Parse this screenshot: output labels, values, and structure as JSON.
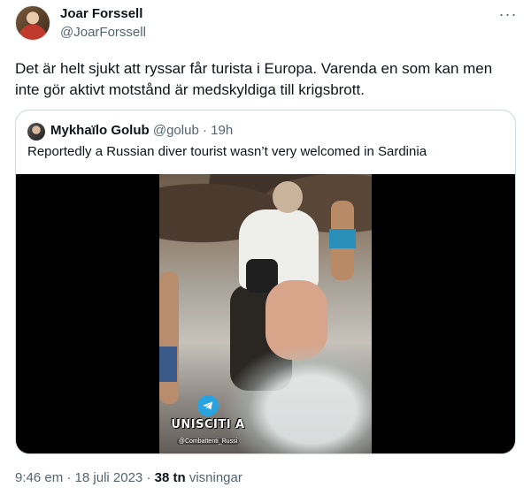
{
  "tweet": {
    "author_name": "Joar Forssell",
    "author_handle": "@JoarForssell",
    "more_icon": "more-horizontal-icon",
    "text": "Det är helt sjukt att ryssar får turista i Europa. Varenda en som kan men inte gör aktivt motstånd är medskyldiga till krigsbrott."
  },
  "quote": {
    "author_name": "Mykhaïlo Golub",
    "author_handle": "@golub",
    "separator": " · ",
    "time": "19h",
    "text": "Reportedly a Russian diver tourist wasn’t very welcomed in Sardinia",
    "video_watermark": {
      "brand": "UNISCITI A",
      "sub": "@Combattenti_Russi",
      "icon": "telegram-icon"
    }
  },
  "footer": {
    "time": "9:46 em",
    "separator": " · ",
    "date": "18 juli 2023",
    "views_count": "38 tn",
    "views_label": "visningar"
  },
  "colors": {
    "text_primary": "#0f1419",
    "text_secondary": "#536471",
    "border": "#cfd9de",
    "telegram_blue": "#29a3e0"
  }
}
